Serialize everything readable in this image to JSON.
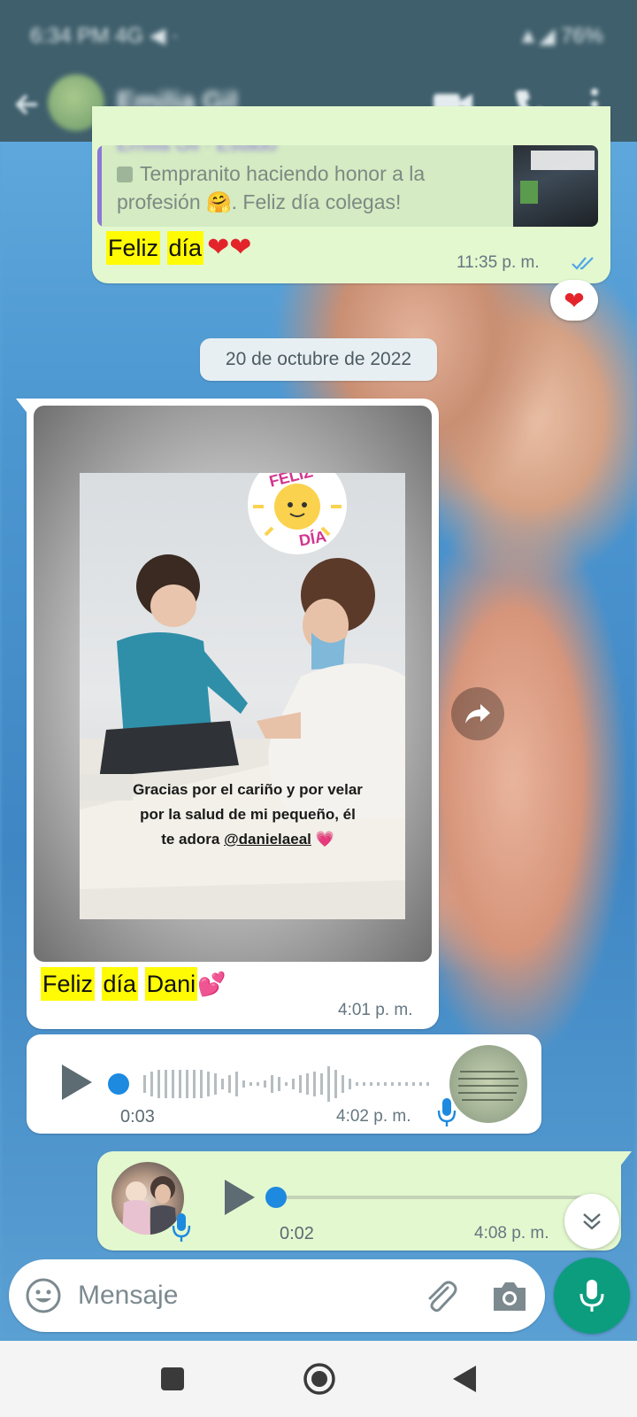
{
  "status_bar": {
    "left": "6:34 PM 4G ◀ ·",
    "right": "▲◢ 76%"
  },
  "chat_header": {
    "contact_name": "Emilia Gil"
  },
  "messages": {
    "quoted_message": {
      "author": "Emilia Gil · Estado",
      "text": "Tempranito haciendo honor a la profesión 🤗.  Feliz día colegas!"
    },
    "reply": {
      "word1": "Feliz",
      "word2": "día",
      "emoji": "❤❤",
      "time": "11:35 p. m.",
      "reaction": "❤"
    },
    "date_separator": "20 de octubre de 2022",
    "image_message": {
      "sticker_line1": "FELIZ",
      "sticker_line2": "DÍA",
      "story_caption": "Gracias por el cariño y por velar por la salud de mi pequeño, él te adora",
      "story_mention": "@danielaeal",
      "story_emoji": "💗",
      "caption_word1": "Feliz",
      "caption_word2": "día",
      "caption_word3": "Dani",
      "caption_emoji": "💕",
      "time": "4:01 p. m."
    },
    "voice_in": {
      "duration": "0:03",
      "time": "4:02 p. m."
    },
    "voice_out": {
      "duration": "0:02",
      "time": "4:08 p. m."
    }
  },
  "compose": {
    "placeholder": "Mensaje"
  },
  "colors": {
    "header": "#3f5f6c",
    "outgoing_bubble": "#e3f8cf",
    "incoming_bubble": "#ffffff",
    "accent": "#0c9d7e",
    "highlight": "#fffb04",
    "audio_progress": "#1d8ae0"
  }
}
